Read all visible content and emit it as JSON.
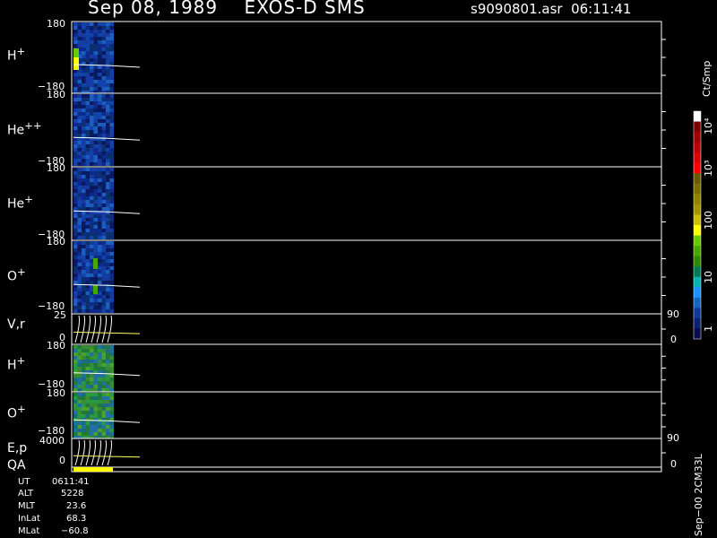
{
  "header": {
    "title": "Sep 08, 1989    EXOS-D SMS",
    "file_time": "s9090801.asr  06:11:41"
  },
  "panels": [
    {
      "label": "H",
      "sup": "+",
      "ytop": "180",
      "ybot": "−180"
    },
    {
      "label": "He",
      "sup": "++",
      "ytop": "180",
      "ybot": "−180"
    },
    {
      "label": "He",
      "sup": "+",
      "ytop": "180",
      "ybot": "−180"
    },
    {
      "label": "O",
      "sup": "+",
      "ytop": "180",
      "ybot": "−180"
    },
    {
      "label": "V,r",
      "sup": "",
      "ytop": "25",
      "ybot": "0",
      "rtop": "90",
      "rbot": "0"
    },
    {
      "label": "H",
      "sup": "+",
      "ytop": "180",
      "ybot": "−180"
    },
    {
      "label": "O",
      "sup": "+",
      "ytop": "180",
      "ybot": "−180"
    },
    {
      "label": "E,p",
      "sup": "",
      "ytop": "4000",
      "ybot": "0",
      "rtop": "90",
      "rbot": "0"
    },
    {
      "label": "QA",
      "sup": ""
    }
  ],
  "colorbar": {
    "unit": "Ct/Smp",
    "labels": [
      "10⁴",
      "10³",
      "100",
      "10",
      "1"
    ],
    "colors": [
      "#ffffff",
      "#7a0000",
      "#a00000",
      "#c00000",
      "#e00000",
      "#ff0000",
      "#6b5b00",
      "#7d6e00",
      "#8f8300",
      "#a39500",
      "#c8c000",
      "#ffff00",
      "#66cc00",
      "#44aa00",
      "#2a8a00",
      "#007a55",
      "#00b3b3",
      "#1e90ff",
      "#1565c0",
      "#0d3a99",
      "#0a2070",
      "#0a0a50"
    ]
  },
  "info": [
    {
      "key": "UT",
      "val": "0611:41"
    },
    {
      "key": "ALT",
      "val": "5228"
    },
    {
      "key": "MLT",
      "val": "23.6"
    },
    {
      "key": "InLat",
      "val": "68.3"
    },
    {
      "key": "MLat",
      "val": "−60.8"
    }
  ],
  "footer_code": "Sep−00 2CM33L"
}
